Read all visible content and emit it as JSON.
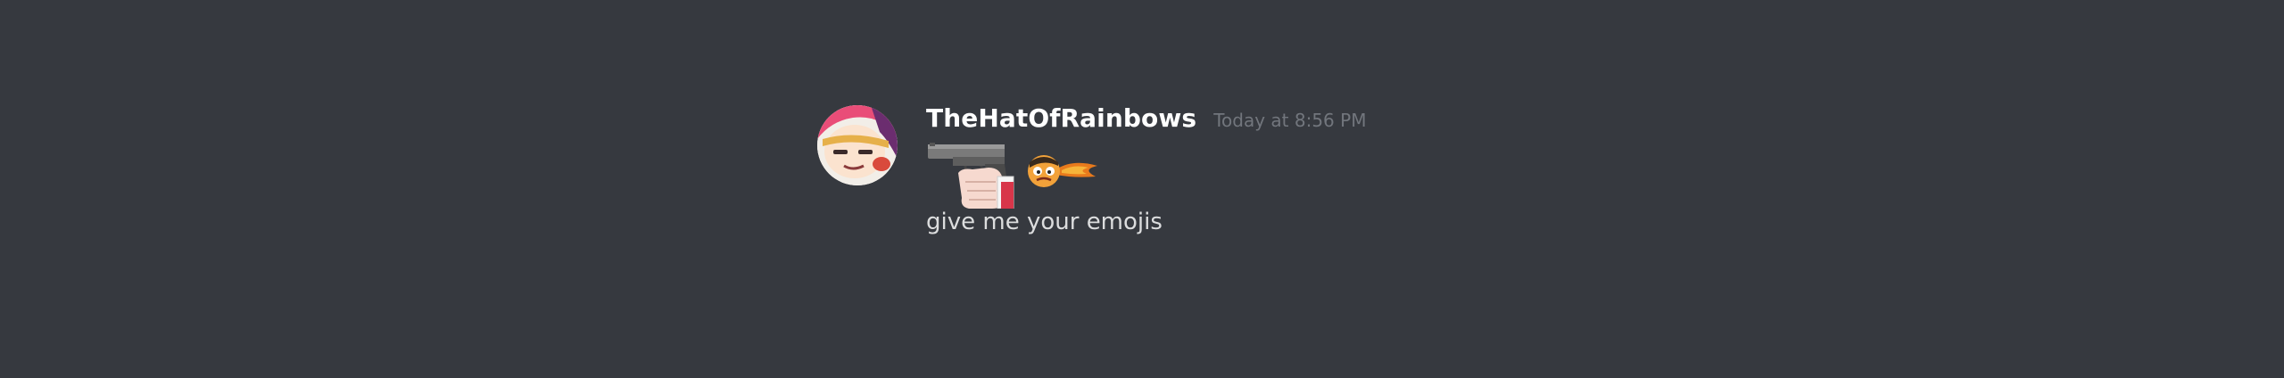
{
  "message": {
    "username": "TheHatOfRainbows",
    "timestamp": "Today at 8:56 PM",
    "content": "give me your emojis",
    "avatar": "user-avatar",
    "emojis": [
      "pointing-gun-emoji",
      "angry-fish-face-emoji"
    ]
  },
  "colors": {
    "background": "#36393f",
    "username": "#ffffff",
    "timestamp": "#72767d",
    "content": "#dcddde"
  }
}
